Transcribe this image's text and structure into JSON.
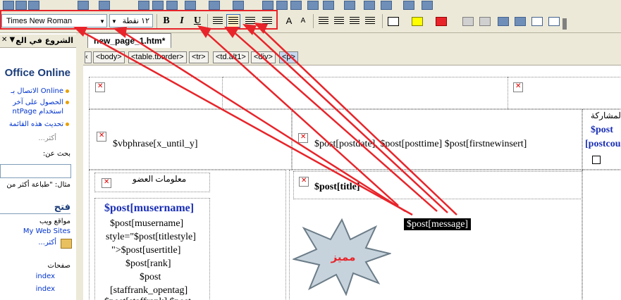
{
  "toolbar": {
    "font_name": "Times New Roman",
    "font_size": "١٢ نقطة",
    "bold": "B",
    "italic": "I",
    "underline": "U",
    "font_grow": "A",
    "font_shrink": "A"
  },
  "pane": {
    "header": "الشروع في الع",
    "office_online": "Office Online",
    "links": [
      "Online الاتصال بـ",
      "الحصول على آخر",
      "استخدام ntPage",
      "تحديث هذه القائمة"
    ],
    "more": "أكثر...",
    "search_label": "بحث عن:",
    "example": "مثال: \"طباعة أكثر من",
    "open_heading": "فتح",
    "websites_label": "مواقع ويب",
    "my_web_sites": "My Web Sites",
    "more2": "أكثر...",
    "pages_label": "صفحات",
    "page1": "index",
    "page2": "index"
  },
  "tab": {
    "label": "new_page_1.htm*"
  },
  "breadcrumbs": [
    "<body>",
    "<table.tborder>",
    "<tr>",
    "<td.alt1>",
    "<div>",
    "<p>"
  ],
  "editor": {
    "cell_participation": "المشاركة",
    "post_label": "$post",
    "postcount": "[postcou",
    "vbphrase": "$vbphrase[x_until_y]",
    "postdate": "$post[postdate], $post[posttime] $post[firstnewinsert]",
    "member_info": "معلومات العضو",
    "title": "$post[title]",
    "musername": "$post[musername]",
    "user_lines": [
      "$post[musername]",
      "style=\"$post[titlestyle]",
      "\">$post[usertitle]",
      "$post[rank]",
      "$post",
      "[staffrank_opentag]"
    ],
    "partial_line": "$post[staffrank] $post"
  },
  "tooltip": {
    "text": "$post[message]"
  },
  "badge": {
    "text": "مميز",
    "color": "#e8242a"
  },
  "colors": {
    "arrow": "#e8242a",
    "link": "#0033cc",
    "bluebold": "#1a2fb5"
  }
}
